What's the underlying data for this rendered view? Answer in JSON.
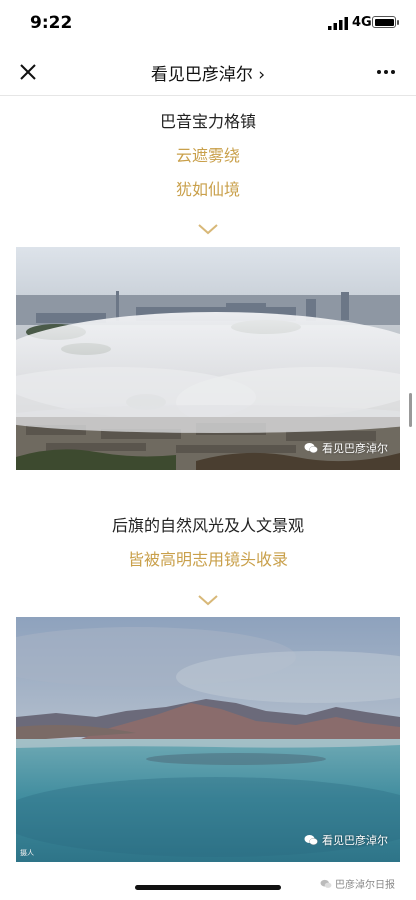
{
  "status": {
    "time": "9:22",
    "network": "4G"
  },
  "nav": {
    "title": "看见巴彦淖尔 ›"
  },
  "section1": {
    "line1": "巴音宝力格镇",
    "line2": "云遮雾绕",
    "line3": "犹如仙境"
  },
  "photo1": {
    "watermark": "看见巴彦淖尔"
  },
  "section2": {
    "line1": "后旗的自然风光及人文景观",
    "line2": "皆被高明志用镜头收录"
  },
  "photo2": {
    "watermark": "看见巴彦淖尔",
    "credit": "摄人"
  },
  "footer": {
    "source": "巴彦淖尔日报"
  },
  "colors": {
    "gold": "#c9a04b"
  },
  "icons": [
    "close-icon",
    "more-icon",
    "chevron-down-icon",
    "wechat-icon",
    "signal-icon",
    "battery-icon"
  ]
}
